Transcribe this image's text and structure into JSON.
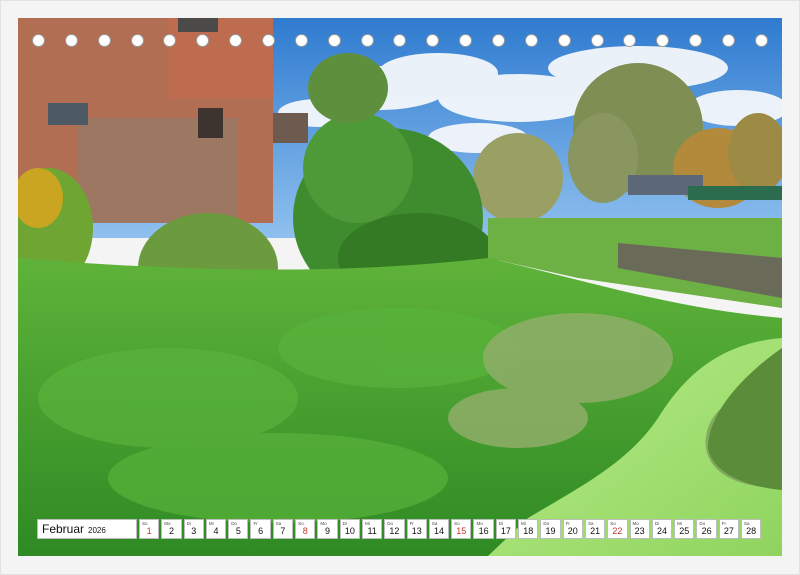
{
  "calendar": {
    "month": "Februar",
    "year": "2026",
    "days": [
      {
        "wd": "So",
        "num": "1",
        "sunday": true
      },
      {
        "wd": "Mo",
        "num": "2"
      },
      {
        "wd": "Di",
        "num": "3"
      },
      {
        "wd": "Mi",
        "num": "4"
      },
      {
        "wd": "Do",
        "num": "5"
      },
      {
        "wd": "Fr",
        "num": "6"
      },
      {
        "wd": "Sa",
        "num": "7"
      },
      {
        "wd": "So",
        "num": "8",
        "sunday": true
      },
      {
        "wd": "Mo",
        "num": "9"
      },
      {
        "wd": "Di",
        "num": "10"
      },
      {
        "wd": "Mi",
        "num": "11"
      },
      {
        "wd": "Do",
        "num": "12"
      },
      {
        "wd": "Fr",
        "num": "13"
      },
      {
        "wd": "Sa",
        "num": "14"
      },
      {
        "wd": "So",
        "num": "15",
        "sunday": true
      },
      {
        "wd": "Mo",
        "num": "16"
      },
      {
        "wd": "Di",
        "num": "17"
      },
      {
        "wd": "Mi",
        "num": "18"
      },
      {
        "wd": "Do",
        "num": "19"
      },
      {
        "wd": "Fr",
        "num": "20"
      },
      {
        "wd": "Sa",
        "num": "21"
      },
      {
        "wd": "So",
        "num": "22",
        "sunday": true
      },
      {
        "wd": "Mo",
        "num": "23"
      },
      {
        "wd": "Di",
        "num": "24"
      },
      {
        "wd": "Mi",
        "num": "25"
      },
      {
        "wd": "Do",
        "num": "26"
      },
      {
        "wd": "Fr",
        "num": "27"
      },
      {
        "wd": "Sa",
        "num": "28"
      }
    ]
  },
  "binding": {
    "hole_count": 23
  },
  "colors": {
    "sky": "#4a8fd6",
    "grass": "#3f9a2c",
    "duckweed_water": "#a9e07a",
    "brick": "#b0513a",
    "sunday_text": "#c0392b"
  }
}
